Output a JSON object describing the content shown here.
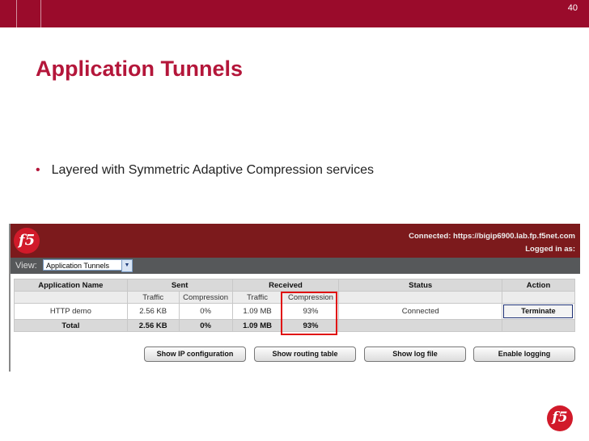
{
  "slide": {
    "number": "40",
    "title": "Application Tunnels",
    "bullet": "Layered with Symmetric Adaptive Compression services"
  },
  "app": {
    "logo": "f5",
    "connected": "Connected: https://bigip6900.lab.fp.f5net.com",
    "logged_in": "Logged in as:",
    "view_label": "View:",
    "view_selected": "Application Tunnels"
  },
  "table": {
    "headers": [
      "Application Name",
      "Sent",
      "Received",
      "Status",
      "Action"
    ],
    "subheaders": [
      "Traffic",
      "Compression",
      "Traffic",
      "Compression"
    ],
    "row": {
      "name": "HTTP demo",
      "sent_traffic": "2.56 KB",
      "sent_compression": "0%",
      "received_traffic": "1.09 MB",
      "received_compression": "93%",
      "status": "Connected",
      "action": "Terminate"
    },
    "total": {
      "label": "Total",
      "sent_traffic": "2.56 KB",
      "sent_compression": "0%",
      "received_traffic": "1.09 MB",
      "received_compression": "93%"
    }
  },
  "buttons": {
    "show_ip": "Show IP configuration",
    "show_routing": "Show routing table",
    "show_log": "Show log file",
    "enable_logging": "Enable logging"
  },
  "colors": {
    "brand_red": "#9a0b2b",
    "title_red": "#b4163a",
    "highlight": "#e01010"
  }
}
